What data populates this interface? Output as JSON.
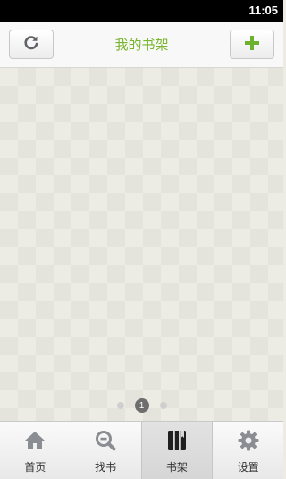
{
  "status_bar": {
    "time": "11:05"
  },
  "header": {
    "title": "我的书架",
    "refresh_icon": "refresh-icon",
    "add_icon": "plus-icon",
    "accent_color": "#79b52e"
  },
  "pager": {
    "current_page": "1",
    "total_pages": 3
  },
  "tabs": [
    {
      "label": "首页",
      "icon": "home-icon"
    },
    {
      "label": "找书",
      "icon": "search-book-icon"
    },
    {
      "label": "书架",
      "icon": "bookshelf-icon",
      "active": true
    },
    {
      "label": "设置",
      "icon": "gear-icon"
    }
  ]
}
